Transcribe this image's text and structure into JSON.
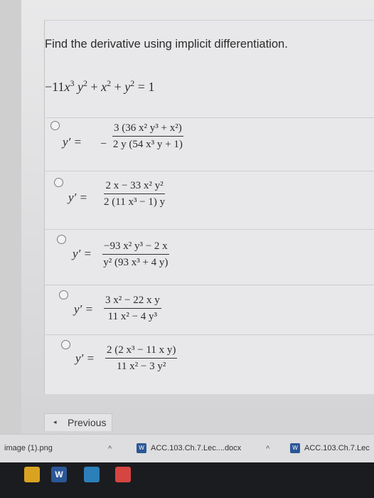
{
  "question": "Find the derivative using implicit differentiation.",
  "equation": {
    "lhs_parts": [
      "−11",
      "x",
      "3",
      " ",
      "y",
      "2",
      " + ",
      "x",
      "2",
      " + ",
      "y",
      "2"
    ],
    "rhs": "1"
  },
  "options": [
    {
      "yprime": "y′ =",
      "sign": "−",
      "num": "3 (36 x² y³ + x²)",
      "den": "2 y (54 x³ y + 1)"
    },
    {
      "yprime": "y′ =",
      "sign": "",
      "num": "2 x − 33 x² y²",
      "den": "2 (11 x³ − 1) y"
    },
    {
      "yprime": "y′ =",
      "sign": "",
      "num": "−93 x² y³ − 2 x",
      "den": "y² (93 x³ + 4 y)"
    },
    {
      "yprime": "y′ =",
      "sign": "",
      "num": "3 x² − 22 x y",
      "den": "11 x² − 4 y³"
    },
    {
      "yprime": "y′ =",
      "sign": "",
      "num": "2 (2 x³ − 11 x y)",
      "den": "11 x² − 3 y²"
    }
  ],
  "nav": {
    "previous_label": "Previous",
    "previous_arrow": "◂"
  },
  "downloads": [
    {
      "name": "image (1).png"
    },
    {
      "name": "ACC.103.Ch.7.Lec....docx"
    },
    {
      "name": "ACC.103.Ch.7.Lec"
    }
  ],
  "taskbar": {
    "word_label": "W"
  }
}
